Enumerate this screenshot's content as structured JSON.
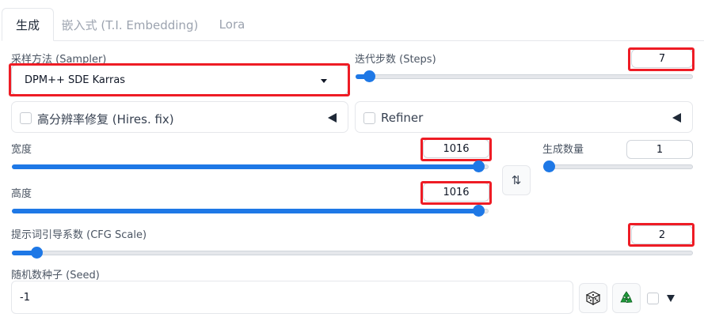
{
  "tabs": [
    {
      "label": "生成",
      "active": true
    },
    {
      "label": "嵌入式 (T.I. Embedding)",
      "active": false
    },
    {
      "label": "Lora",
      "active": false
    }
  ],
  "sampler": {
    "label": "采样方法 (Sampler)",
    "value": "DPM++ SDE Karras"
  },
  "steps": {
    "label": "迭代步数 (Steps)",
    "value": "7",
    "fraction": 0.039
  },
  "hires_fix": {
    "label": "高分辨率修复 (Hires. fix)",
    "checked": false
  },
  "refiner": {
    "label": "Refiner",
    "checked": false
  },
  "width": {
    "label": "宽度",
    "value": "1016",
    "fraction": 0.978
  },
  "height": {
    "label": "高度",
    "value": "1016",
    "fraction": 0.978
  },
  "swap_icon": "swap-vertical-arrows-icon",
  "batch_count": {
    "label": "生成数量",
    "value": "1",
    "fraction": 0.0
  },
  "cfg_scale": {
    "label": "提示词引导系数 (CFG Scale)",
    "value": "2",
    "fraction": 0.036
  },
  "seed": {
    "label": "随机数种子 (Seed)",
    "value": "-1"
  },
  "seed_buttons": {
    "random": "dice-icon",
    "reuse": "recycle-icon"
  },
  "colors": {
    "accent": "#1e78e6",
    "highlight": "#ee1c25"
  }
}
